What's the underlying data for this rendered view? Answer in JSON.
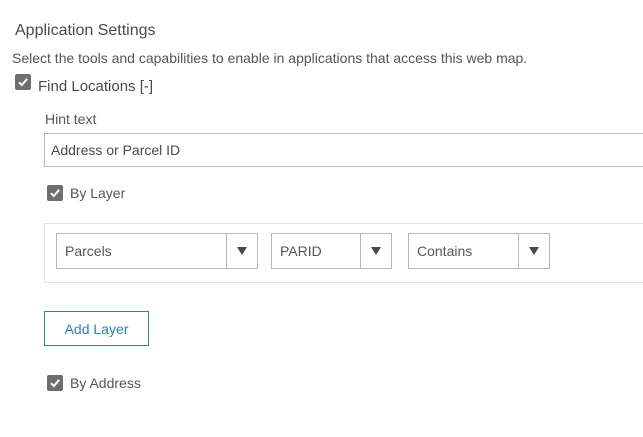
{
  "settings": {
    "title": "Application Settings",
    "description": "Select the tools and capabilities to enable in applications that access this web map."
  },
  "find_locations": {
    "label": "Find Locations",
    "toggle": "[-]",
    "checked": true,
    "hint_label": "Hint text",
    "hint_value": "Address or Parcel ID",
    "by_layer": {
      "label": "By Layer",
      "checked": true,
      "layer_select": "Parcels",
      "field_select": "PARID",
      "operator_select": "Contains"
    },
    "add_layer_label": "Add Layer",
    "by_address": {
      "label": "By Address",
      "checked": true
    }
  },
  "colors": {
    "accent": "#2d7fb8",
    "checkbox": "#6e6e6e",
    "text": "#4c4c4c"
  }
}
